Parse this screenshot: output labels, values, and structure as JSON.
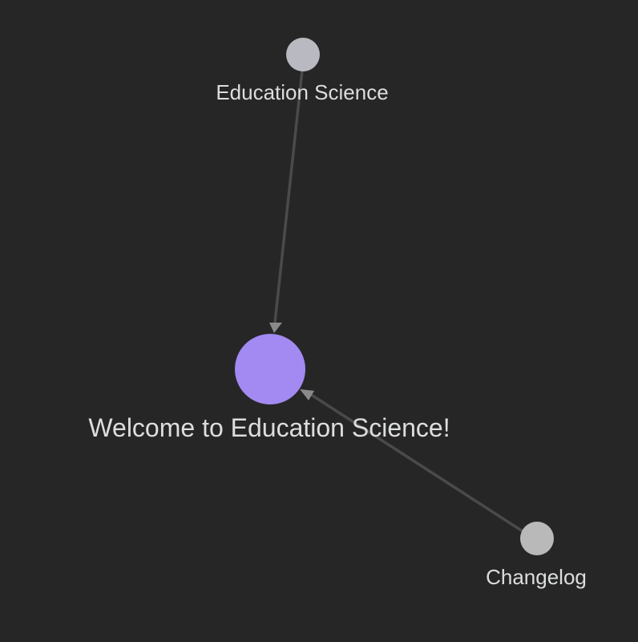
{
  "graph": {
    "nodes": [
      {
        "id": "education-science",
        "label": "Education Science",
        "color": "#b9b9c2",
        "active": false
      },
      {
        "id": "welcome",
        "label": "Welcome to Education Science!",
        "color": "#a28af2",
        "active": true
      },
      {
        "id": "changelog",
        "label": "Changelog",
        "color": "#b9b9b9",
        "active": false
      }
    ],
    "links": [
      {
        "from": "education-science",
        "to": "welcome"
      },
      {
        "from": "changelog",
        "to": "welcome"
      }
    ],
    "colors": {
      "background": "#262626",
      "link": "#4a4a4a",
      "arrow": "#8a8a8a",
      "label": "#dcddde"
    }
  }
}
